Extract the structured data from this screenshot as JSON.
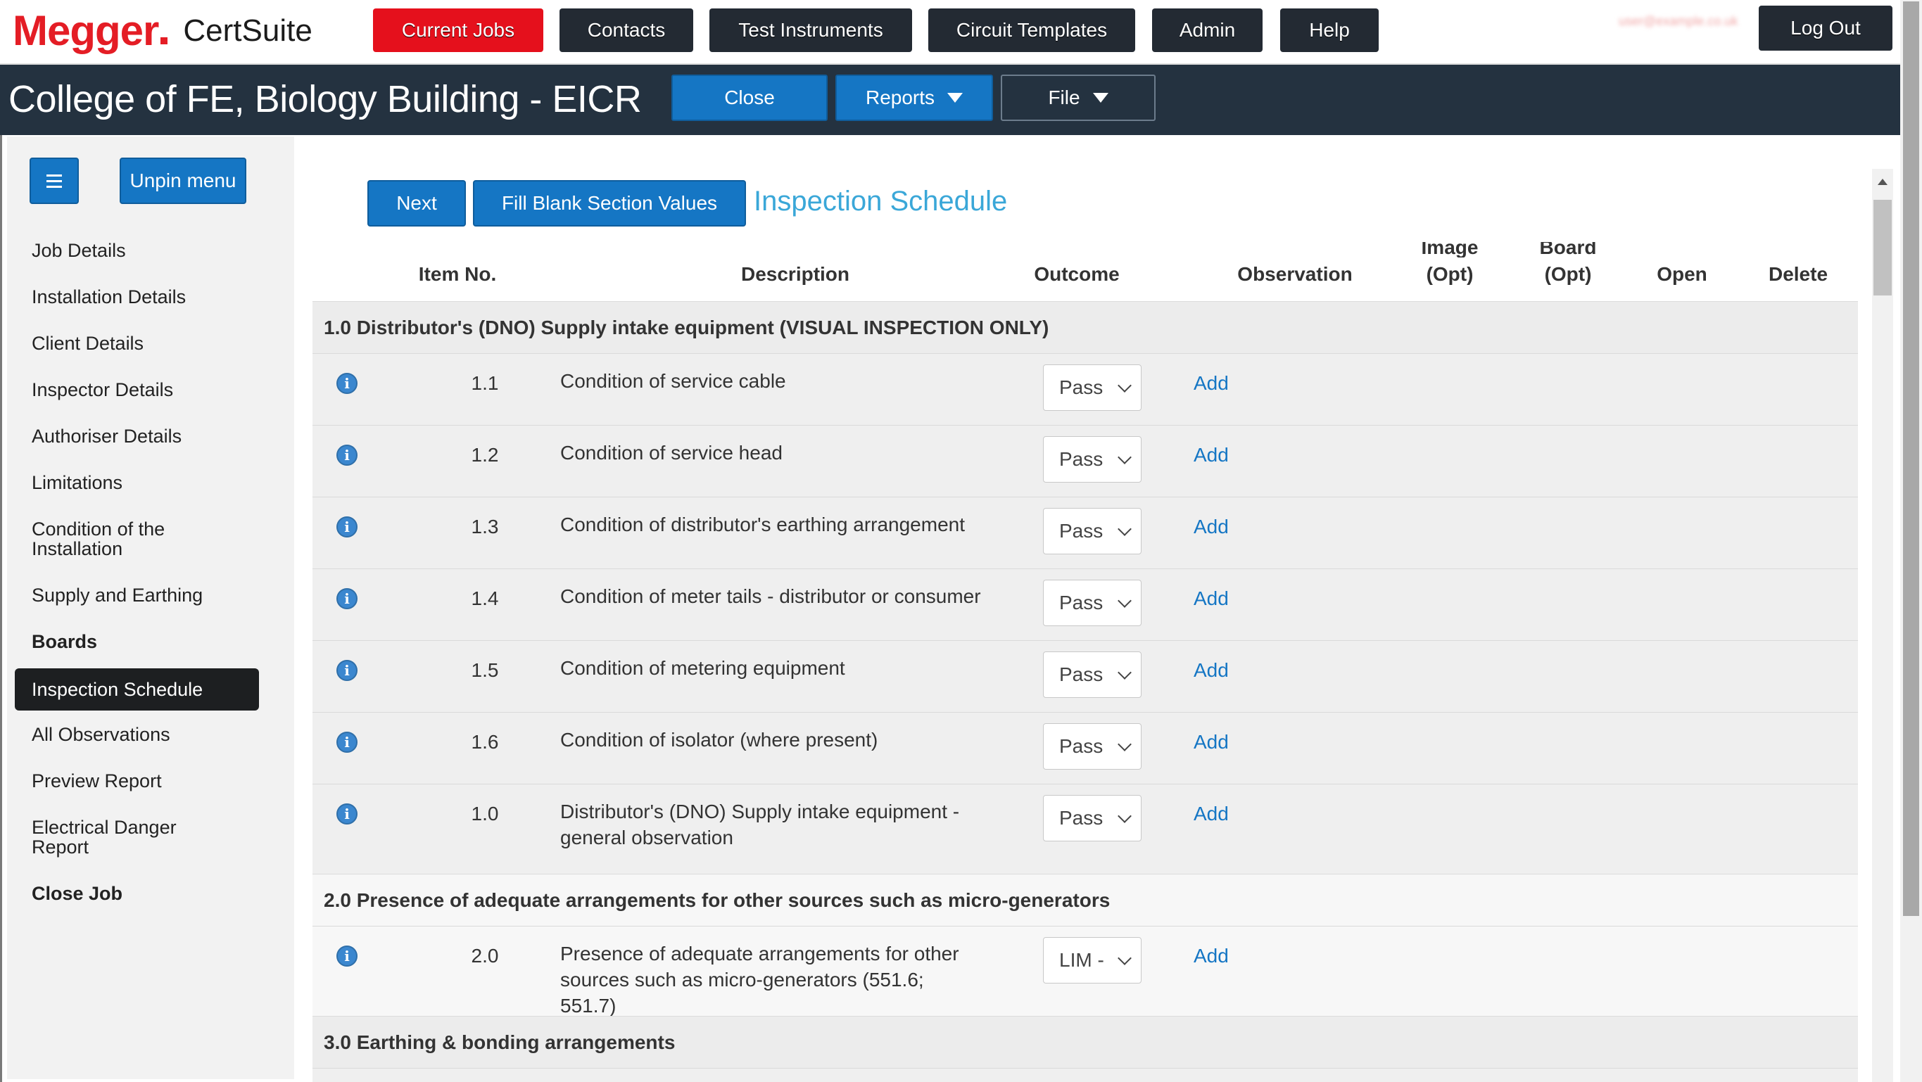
{
  "brand": {
    "logo_text": "Megger",
    "product": "CertSuite"
  },
  "topnav": {
    "items": [
      "Current Jobs",
      "Contacts",
      "Test Instruments",
      "Circuit Templates",
      "Admin",
      "Help"
    ],
    "active": "Current Jobs",
    "logout": "Log Out",
    "user_email": "user@example.co.uk"
  },
  "jobbar": {
    "title": "College of FE, Biology Building - EICR",
    "close": "Close",
    "reports": "Reports",
    "file": "File"
  },
  "sidebar": {
    "unpin": "Unpin menu",
    "items": [
      {
        "label": "Job Details"
      },
      {
        "label": "Installation Details"
      },
      {
        "label": "Client Details"
      },
      {
        "label": "Inspector Details"
      },
      {
        "label": "Authoriser Details"
      },
      {
        "label": "Limitations"
      },
      {
        "label": "Condition of the Installation"
      },
      {
        "label": "Supply and Earthing"
      },
      {
        "label": "Boards"
      },
      {
        "label": "Inspection Schedule"
      },
      {
        "label": "All Observations"
      },
      {
        "label": "Preview Report"
      },
      {
        "label": "Electrical Danger Report"
      },
      {
        "label": "Close Job"
      }
    ],
    "selected": "Inspection Schedule"
  },
  "main": {
    "next": "Next",
    "fill_blank": "Fill Blank Section Values",
    "heading": "Inspection Schedule",
    "columns": {
      "item_no": "Item No.",
      "description": "Description",
      "outcome": "Outcome",
      "observation": "Observation",
      "image_top": "Image",
      "image": "(Opt)",
      "board_top": "Board",
      "board": "(Opt)",
      "open": "Open",
      "delete": "Delete"
    },
    "add_label": "Add",
    "sections": [
      {
        "title": "1.0 Distributor's (DNO) Supply intake equipment (VISUAL INSPECTION ONLY)",
        "items": [
          {
            "no": "1.1",
            "desc": "Condition of service cable",
            "outcome": "Pass"
          },
          {
            "no": "1.2",
            "desc": "Condition of service head",
            "outcome": "Pass"
          },
          {
            "no": "1.3",
            "desc": "Condition of distributor's earthing arrangement",
            "outcome": "Pass"
          },
          {
            "no": "1.4",
            "desc": "Condition of meter tails - distributor or consumer",
            "outcome": "Pass"
          },
          {
            "no": "1.5",
            "desc": "Condition of metering equipment",
            "outcome": "Pass"
          },
          {
            "no": "1.6",
            "desc": "Condition of isolator (where present)",
            "outcome": "Pass"
          },
          {
            "no": "1.0",
            "desc": "Distributor's (DNO) Supply intake equipment - general observation",
            "outcome": "Pass"
          }
        ]
      },
      {
        "title": "2.0 Presence of adequate arrangements for other sources such as micro-generators",
        "items": [
          {
            "no": "2.0",
            "desc": "Presence of adequate arrangements for other sources such as micro-generators (551.6; 551.7)",
            "outcome": "LIM -"
          }
        ]
      },
      {
        "title": "3.0 Earthing & bonding arrangements",
        "items": []
      }
    ]
  }
}
